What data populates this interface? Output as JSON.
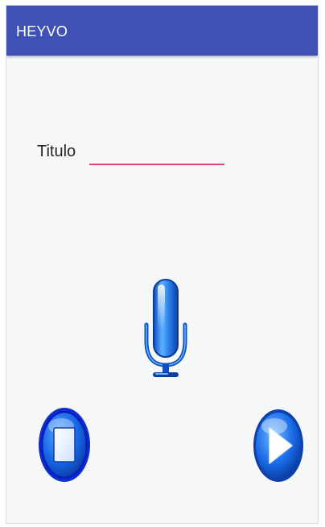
{
  "app_bar": {
    "title": "HEYVO",
    "color": "#3f51b5"
  },
  "form": {
    "title_label": "Titulo",
    "title_value": "",
    "title_placeholder": ""
  },
  "controls": {
    "mic_icon": "microphone-icon",
    "stop_icon": "stop-icon",
    "play_icon": "play-icon",
    "accent_color": "#1565e6"
  }
}
